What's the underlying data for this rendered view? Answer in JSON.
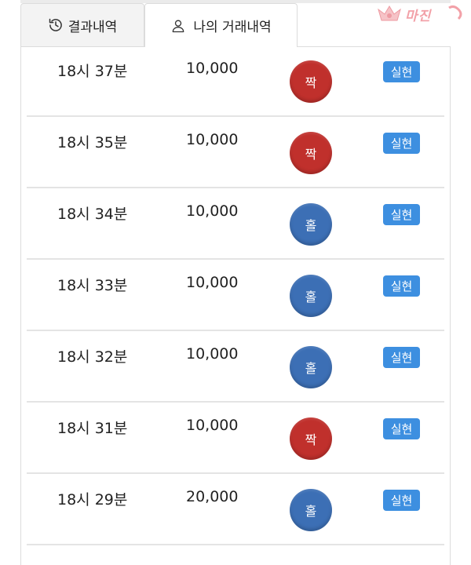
{
  "logo": {
    "text": "마진",
    "colors": {
      "primary": "#f2a1a8"
    }
  },
  "tabs": [
    {
      "label": "결과내역",
      "icon": "history-icon",
      "active": false
    },
    {
      "label": "나의 거래내역",
      "icon": "user-icon",
      "active": true
    }
  ],
  "colors": {
    "even_ball": "#c0302c",
    "odd_ball": "#3c6fb5",
    "badge": "#3d8fe0",
    "divider": "#e4e4e4"
  },
  "trades": [
    {
      "time": "18시 37분",
      "amount": "10,000",
      "pick": "짝",
      "pick_type": "even",
      "status": "실현"
    },
    {
      "time": "18시 35분",
      "amount": "10,000",
      "pick": "짝",
      "pick_type": "even",
      "status": "실현"
    },
    {
      "time": "18시 34분",
      "amount": "10,000",
      "pick": "홀",
      "pick_type": "odd",
      "status": "실현"
    },
    {
      "time": "18시 33분",
      "amount": "10,000",
      "pick": "홀",
      "pick_type": "odd",
      "status": "실현"
    },
    {
      "time": "18시 32분",
      "amount": "10,000",
      "pick": "홀",
      "pick_type": "odd",
      "status": "실현"
    },
    {
      "time": "18시 31분",
      "amount": "10,000",
      "pick": "짝",
      "pick_type": "even",
      "status": "실현"
    },
    {
      "time": "18시 29분",
      "amount": "20,000",
      "pick": "홀",
      "pick_type": "odd",
      "status": "실현"
    }
  ]
}
